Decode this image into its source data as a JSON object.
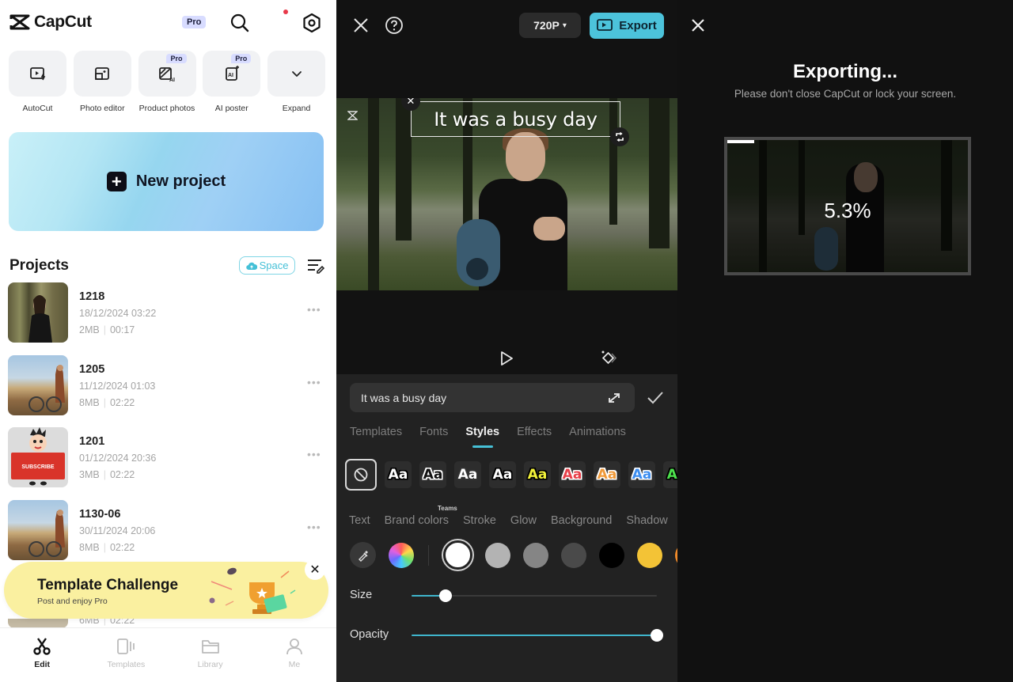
{
  "home": {
    "app_name": "CapCut",
    "pro_badge": "Pro",
    "tools": [
      {
        "label": "AutoCut",
        "icon": "autocut-icon",
        "pro": false
      },
      {
        "label": "Photo editor",
        "icon": "photo-editor-icon",
        "pro": false
      },
      {
        "label": "Product photos",
        "icon": "product-photos-icon",
        "pro": true,
        "badge": "Pro"
      },
      {
        "label": "AI poster",
        "icon": "ai-poster-icon",
        "pro": true,
        "badge": "Pro"
      },
      {
        "label": "Expand",
        "icon": "chevron-down-icon",
        "pro": false
      }
    ],
    "new_project_label": "New project",
    "projects_title": "Projects",
    "space_label": "Space",
    "projects": [
      {
        "name": "1218",
        "date": "18/12/2024 03:22",
        "size": "2MB",
        "duration": "00:17"
      },
      {
        "name": "1205",
        "date": "11/12/2024 01:03",
        "size": "8MB",
        "duration": "02:22"
      },
      {
        "name": "1201",
        "date": "01/12/2024 20:36",
        "size": "3MB",
        "duration": "02:22"
      },
      {
        "name": "1130-06",
        "date": "30/11/2024 20:06",
        "size": "8MB",
        "duration": "02:22"
      }
    ],
    "partial_project": {
      "size": "6MB",
      "duration": "02:22"
    },
    "thumb_text_subscribe": "SUBSCRIBE",
    "more_label": "•••",
    "banner": {
      "title": "Template Challenge",
      "subtitle": "Post and enjoy Pro",
      "close": "✕"
    },
    "tabs": [
      {
        "label": "Edit",
        "active": true
      },
      {
        "label": "Templates",
        "active": false
      },
      {
        "label": "Library",
        "active": false
      },
      {
        "label": "Me",
        "active": false
      }
    ]
  },
  "editor": {
    "resolution": "720P",
    "resolution_caret": "▾",
    "export_label": "Export",
    "caption": "It was a busy day",
    "caption_delete": "✕",
    "text_value": "It was a busy day",
    "style_tabs": [
      {
        "label": "Templates",
        "active": false
      },
      {
        "label": "Fonts",
        "active": false
      },
      {
        "label": "Styles",
        "active": true
      },
      {
        "label": "Effects",
        "active": false
      },
      {
        "label": "Animations",
        "active": false
      }
    ],
    "presets": [
      {
        "text": "Aa",
        "fill": "#ffffff",
        "stroke": "#000000"
      },
      {
        "text": "Aa",
        "fill": "#111111",
        "stroke": "#ffffff"
      },
      {
        "text": "Aa",
        "fill": "#ffffff",
        "stroke": "#333333"
      },
      {
        "text": "Aa",
        "fill": "#ffffff",
        "stroke": "#000000"
      },
      {
        "text": "Aa",
        "fill": "#f2f23a",
        "stroke": "#000000"
      },
      {
        "text": "Aa",
        "fill": "#e8404a",
        "stroke": "#ffffff"
      },
      {
        "text": "Aa",
        "fill": "#f09a3a",
        "stroke": "#ffffff"
      },
      {
        "text": "Aa",
        "fill": "#3d8ef0",
        "stroke": "#ffffff"
      },
      {
        "text": "Aa",
        "fill": "#4de04d",
        "stroke": "#000000"
      }
    ],
    "teams_tag": "Teams",
    "prop_tabs": [
      "Text",
      "Brand colors",
      "Stroke",
      "Glow",
      "Background",
      "Shadow"
    ],
    "swatches": [
      "#ffffff",
      "#b3b3b3",
      "#858585",
      "#4a4a4a",
      "#000000",
      "#f3c336",
      "#f08a2a"
    ],
    "selected_swatch": "#ffffff",
    "size_label": "Size",
    "size_value": 0.14,
    "opacity_label": "Opacity",
    "opacity_value": 1.0,
    "accent_color": "#4cc3db"
  },
  "exporting": {
    "title": "Exporting...",
    "subtitle": "Please don't close CapCut or lock your screen.",
    "percent_text": "5.3%",
    "progress": 0.113
  }
}
